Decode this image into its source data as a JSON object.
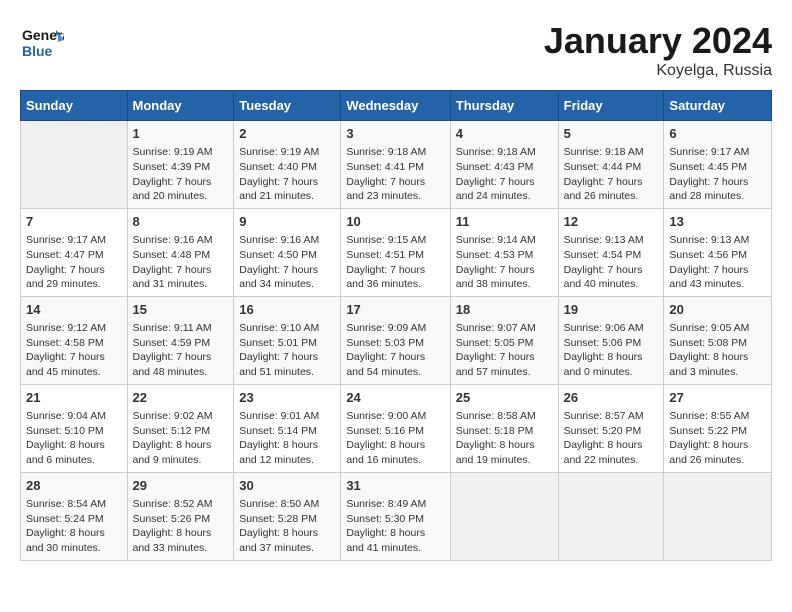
{
  "logo": {
    "line1": "General",
    "line2": "Blue"
  },
  "title": "January 2024",
  "location": "Koyelga, Russia",
  "days_header": [
    "Sunday",
    "Monday",
    "Tuesday",
    "Wednesday",
    "Thursday",
    "Friday",
    "Saturday"
  ],
  "weeks": [
    [
      {
        "num": "",
        "info": ""
      },
      {
        "num": "1",
        "info": "Sunrise: 9:19 AM\nSunset: 4:39 PM\nDaylight: 7 hours\nand 20 minutes."
      },
      {
        "num": "2",
        "info": "Sunrise: 9:19 AM\nSunset: 4:40 PM\nDaylight: 7 hours\nand 21 minutes."
      },
      {
        "num": "3",
        "info": "Sunrise: 9:18 AM\nSunset: 4:41 PM\nDaylight: 7 hours\nand 23 minutes."
      },
      {
        "num": "4",
        "info": "Sunrise: 9:18 AM\nSunset: 4:43 PM\nDaylight: 7 hours\nand 24 minutes."
      },
      {
        "num": "5",
        "info": "Sunrise: 9:18 AM\nSunset: 4:44 PM\nDaylight: 7 hours\nand 26 minutes."
      },
      {
        "num": "6",
        "info": "Sunrise: 9:17 AM\nSunset: 4:45 PM\nDaylight: 7 hours\nand 28 minutes."
      }
    ],
    [
      {
        "num": "7",
        "info": "Sunrise: 9:17 AM\nSunset: 4:47 PM\nDaylight: 7 hours\nand 29 minutes."
      },
      {
        "num": "8",
        "info": "Sunrise: 9:16 AM\nSunset: 4:48 PM\nDaylight: 7 hours\nand 31 minutes."
      },
      {
        "num": "9",
        "info": "Sunrise: 9:16 AM\nSunset: 4:50 PM\nDaylight: 7 hours\nand 34 minutes."
      },
      {
        "num": "10",
        "info": "Sunrise: 9:15 AM\nSunset: 4:51 PM\nDaylight: 7 hours\nand 36 minutes."
      },
      {
        "num": "11",
        "info": "Sunrise: 9:14 AM\nSunset: 4:53 PM\nDaylight: 7 hours\nand 38 minutes."
      },
      {
        "num": "12",
        "info": "Sunrise: 9:13 AM\nSunset: 4:54 PM\nDaylight: 7 hours\nand 40 minutes."
      },
      {
        "num": "13",
        "info": "Sunrise: 9:13 AM\nSunset: 4:56 PM\nDaylight: 7 hours\nand 43 minutes."
      }
    ],
    [
      {
        "num": "14",
        "info": "Sunrise: 9:12 AM\nSunset: 4:58 PM\nDaylight: 7 hours\nand 45 minutes."
      },
      {
        "num": "15",
        "info": "Sunrise: 9:11 AM\nSunset: 4:59 PM\nDaylight: 7 hours\nand 48 minutes."
      },
      {
        "num": "16",
        "info": "Sunrise: 9:10 AM\nSunset: 5:01 PM\nDaylight: 7 hours\nand 51 minutes."
      },
      {
        "num": "17",
        "info": "Sunrise: 9:09 AM\nSunset: 5:03 PM\nDaylight: 7 hours\nand 54 minutes."
      },
      {
        "num": "18",
        "info": "Sunrise: 9:07 AM\nSunset: 5:05 PM\nDaylight: 7 hours\nand 57 minutes."
      },
      {
        "num": "19",
        "info": "Sunrise: 9:06 AM\nSunset: 5:06 PM\nDaylight: 8 hours\nand 0 minutes."
      },
      {
        "num": "20",
        "info": "Sunrise: 9:05 AM\nSunset: 5:08 PM\nDaylight: 8 hours\nand 3 minutes."
      }
    ],
    [
      {
        "num": "21",
        "info": "Sunrise: 9:04 AM\nSunset: 5:10 PM\nDaylight: 8 hours\nand 6 minutes."
      },
      {
        "num": "22",
        "info": "Sunrise: 9:02 AM\nSunset: 5:12 PM\nDaylight: 8 hours\nand 9 minutes."
      },
      {
        "num": "23",
        "info": "Sunrise: 9:01 AM\nSunset: 5:14 PM\nDaylight: 8 hours\nand 12 minutes."
      },
      {
        "num": "24",
        "info": "Sunrise: 9:00 AM\nSunset: 5:16 PM\nDaylight: 8 hours\nand 16 minutes."
      },
      {
        "num": "25",
        "info": "Sunrise: 8:58 AM\nSunset: 5:18 PM\nDaylight: 8 hours\nand 19 minutes."
      },
      {
        "num": "26",
        "info": "Sunrise: 8:57 AM\nSunset: 5:20 PM\nDaylight: 8 hours\nand 22 minutes."
      },
      {
        "num": "27",
        "info": "Sunrise: 8:55 AM\nSunset: 5:22 PM\nDaylight: 8 hours\nand 26 minutes."
      }
    ],
    [
      {
        "num": "28",
        "info": "Sunrise: 8:54 AM\nSunset: 5:24 PM\nDaylight: 8 hours\nand 30 minutes."
      },
      {
        "num": "29",
        "info": "Sunrise: 8:52 AM\nSunset: 5:26 PM\nDaylight: 8 hours\nand 33 minutes."
      },
      {
        "num": "30",
        "info": "Sunrise: 8:50 AM\nSunset: 5:28 PM\nDaylight: 8 hours\nand 37 minutes."
      },
      {
        "num": "31",
        "info": "Sunrise: 8:49 AM\nSunset: 5:30 PM\nDaylight: 8 hours\nand 41 minutes."
      },
      {
        "num": "",
        "info": ""
      },
      {
        "num": "",
        "info": ""
      },
      {
        "num": "",
        "info": ""
      }
    ]
  ]
}
